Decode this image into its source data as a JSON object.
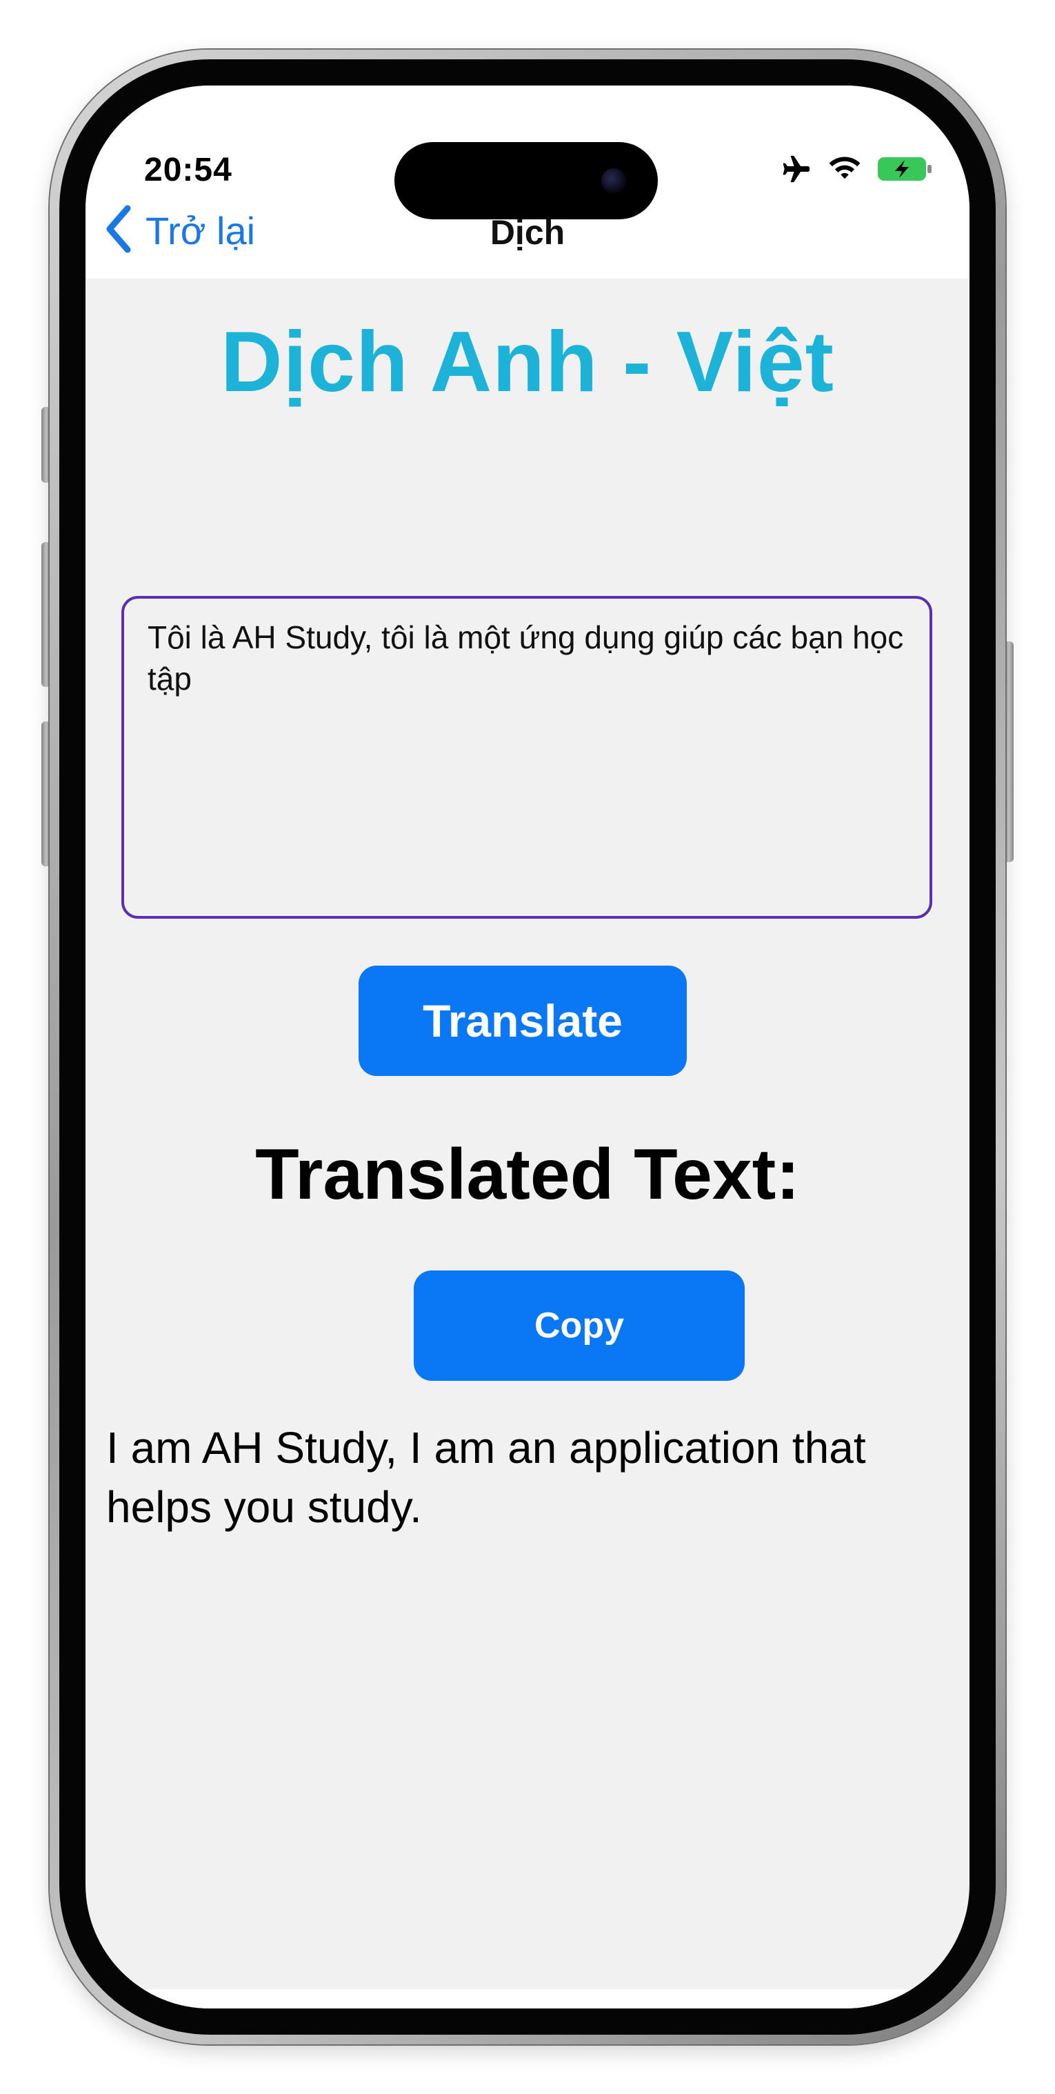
{
  "status_bar": {
    "time": "20:54",
    "icons": [
      "airplane-icon",
      "wifi-icon",
      "battery-charging-icon"
    ]
  },
  "navbar": {
    "back_label": "Trở lại",
    "title": "Dịch"
  },
  "main": {
    "heading": "Dịch Anh - Việt",
    "input_value": "Tôi là AH Study, tôi là một ứng dụng giúp các bạn học tập",
    "translate_button": "Translate",
    "translated_heading": "Translated Text:",
    "copy_button": "Copy",
    "result_text": "I am AH Study, I am an application that helps you study."
  },
  "colors": {
    "accent": "#0a78f5",
    "heading": "#1db2d8",
    "input_border": "#5a2fb0",
    "back_link": "#1a78e6",
    "background": "#f1f1f2"
  }
}
